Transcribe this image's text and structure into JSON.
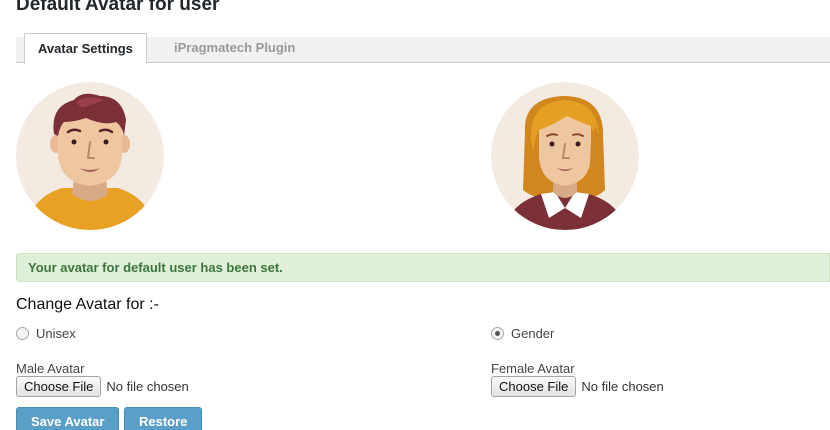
{
  "page": {
    "title": "Default Avatar for user"
  },
  "tabs": [
    {
      "label": "Avatar Settings",
      "active": true
    },
    {
      "label": "iPragmatech Plugin",
      "active": false
    }
  ],
  "avatars": {
    "male": {
      "icon": "male-avatar"
    },
    "female": {
      "icon": "female-avatar"
    }
  },
  "notice": {
    "message": "Your avatar for default user has been set."
  },
  "change_avatar": {
    "heading": "Change Avatar for :-",
    "options": [
      {
        "label": "Unisex",
        "selected": false
      },
      {
        "label": "Gender",
        "selected": true
      }
    ]
  },
  "uploads": {
    "male": {
      "label": "Male Avatar",
      "button": "Choose File",
      "status": "No file chosen"
    },
    "female": {
      "label": "Female Avatar",
      "button": "Choose File",
      "status": "No file chosen"
    }
  },
  "actions": {
    "save": "Save Avatar",
    "restore": "Restore"
  },
  "colors": {
    "notice_bg": "#dff0d8",
    "notice_text": "#3c763d",
    "button_bg": "#5a9fc8",
    "avatar_bg": "#f3ebe2",
    "male_shirt": "#e8a125",
    "male_hair": "#7b2f37",
    "female_hair": "#e4a024",
    "female_top": "#7a3036",
    "skin": "#eec6a0"
  }
}
